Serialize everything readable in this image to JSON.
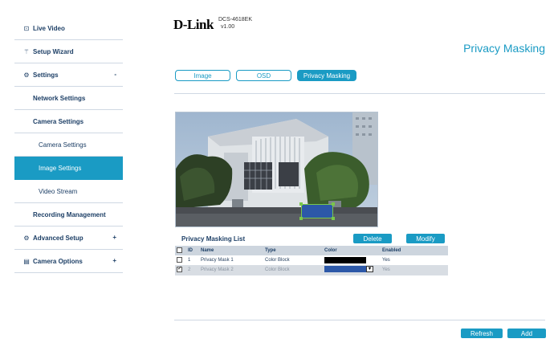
{
  "sidebar": {
    "live_video": "Live Video",
    "setup_wizard": "Setup Wizard",
    "settings": "Settings",
    "settings_sign": "-",
    "network_settings": "Network Settings",
    "camera_settings": "Camera Settings",
    "camera_settings_sub": "Camera Settings",
    "image_settings": "Image Settings",
    "video_stream": "Video Stream",
    "recording_management": "Recording Management",
    "advanced_setup": "Advanced Setup",
    "advanced_sign": "+",
    "camera_options": "Camera Options",
    "camera_options_sign": "+"
  },
  "header": {
    "brand": "D-Link",
    "model": "DCS-4618EK",
    "version": "v1.00",
    "page_title": "Privacy Masking"
  },
  "tabs": {
    "image": "Image",
    "osd": "OSD",
    "privacy_masking": "Privacy Masking"
  },
  "privacy_list": {
    "title": "Privacy Masking List",
    "delete_label": "Delete",
    "modify_label": "Modify",
    "columns": {
      "id": "ID",
      "name": "Name",
      "type": "Type",
      "color": "Color",
      "enabled": "Enabled"
    },
    "rows": [
      {
        "id": "1",
        "name": "Privacy Mask 1",
        "type": "Color Block",
        "color": "#000000",
        "enabled": "Yes",
        "checked": false
      },
      {
        "id": "2",
        "name": "Privacy Mask 2",
        "type": "Color Block",
        "color": "#2c58a8",
        "enabled": "Yes",
        "checked": true
      }
    ]
  },
  "footer": {
    "refresh_label": "Refresh",
    "add_label": "Add"
  },
  "colors": {
    "accent": "#1a9bc4",
    "nav_text": "#1d3f66",
    "mask_blue": "#2c58a8",
    "mask_outline": "#79c74a"
  }
}
